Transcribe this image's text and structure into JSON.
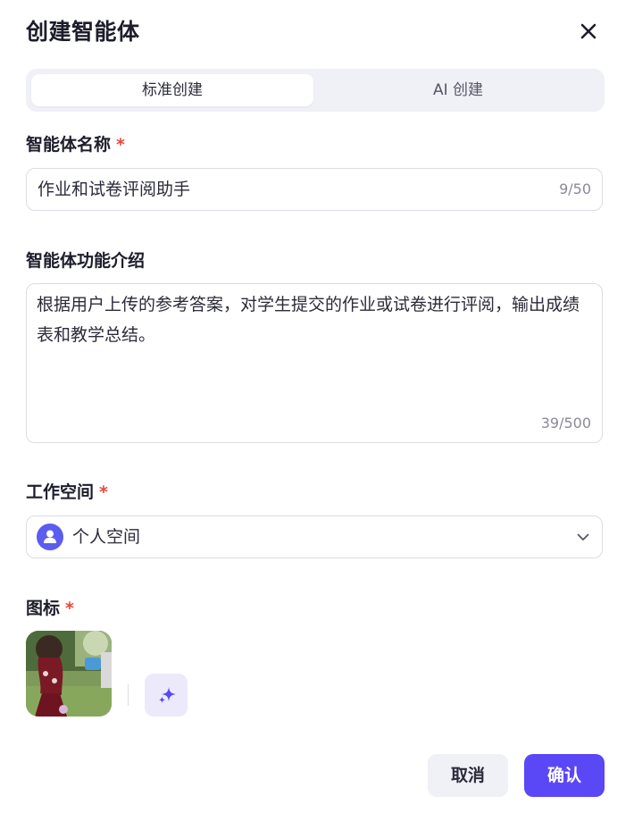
{
  "dialog": {
    "title": "创建智能体"
  },
  "tabs": [
    {
      "label": "标准创建",
      "active": true
    },
    {
      "label": "AI 创建",
      "active": false
    }
  ],
  "fields": {
    "name": {
      "label": "智能体名称",
      "required_mark": "*",
      "value": "作业和试卷评阅助手",
      "counter": "9/50"
    },
    "description": {
      "label": "智能体功能介绍",
      "value": "根据用户上传的参考答案，对学生提交的作业或试卷进行评阅，输出成绩表和教学总结。",
      "counter": "39/500"
    },
    "workspace": {
      "label": "工作空间",
      "required_mark": "*",
      "value": "个人空间",
      "icon": "user-icon"
    },
    "icon": {
      "label": "图标",
      "required_mark": "*"
    }
  },
  "actions": {
    "cancel_label": "取消",
    "confirm_label": "确认"
  },
  "colors": {
    "accent": "#5a47f5",
    "required": "#e5483c",
    "avatar": "#5b5cf0"
  }
}
